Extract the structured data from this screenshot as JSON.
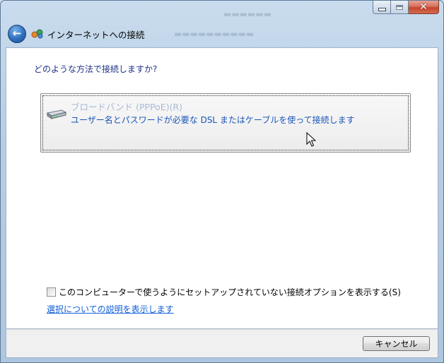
{
  "window": {
    "caption_buttons": {
      "minimize_icon": "minimize-icon",
      "maximize_icon": "maximize-icon",
      "close_symbol": "✕"
    }
  },
  "header": {
    "back_symbol": "←",
    "title": "インターネットへの接続"
  },
  "main": {
    "question": "どのような方法で接続しますか?",
    "options": [
      {
        "title": "ブロードバンド (PPPoE)(R)",
        "description": "ユーザー名とパスワードが必要な DSL またはケーブルを使って接続します",
        "icon": "modem-icon"
      }
    ],
    "show_options_checkbox": {
      "checked": false,
      "label": "このコンピューターで使うようにセットアップされていない接続オプションを表示する(S)"
    },
    "help_link": "選択についての説明を表示します"
  },
  "footer": {
    "cancel_label": "キャンセル"
  },
  "colors": {
    "question_text": "#1e3287",
    "option_title_disabled": "#a9b9d6",
    "option_desc": "#1a56b8",
    "link": "#0f5ed8"
  }
}
